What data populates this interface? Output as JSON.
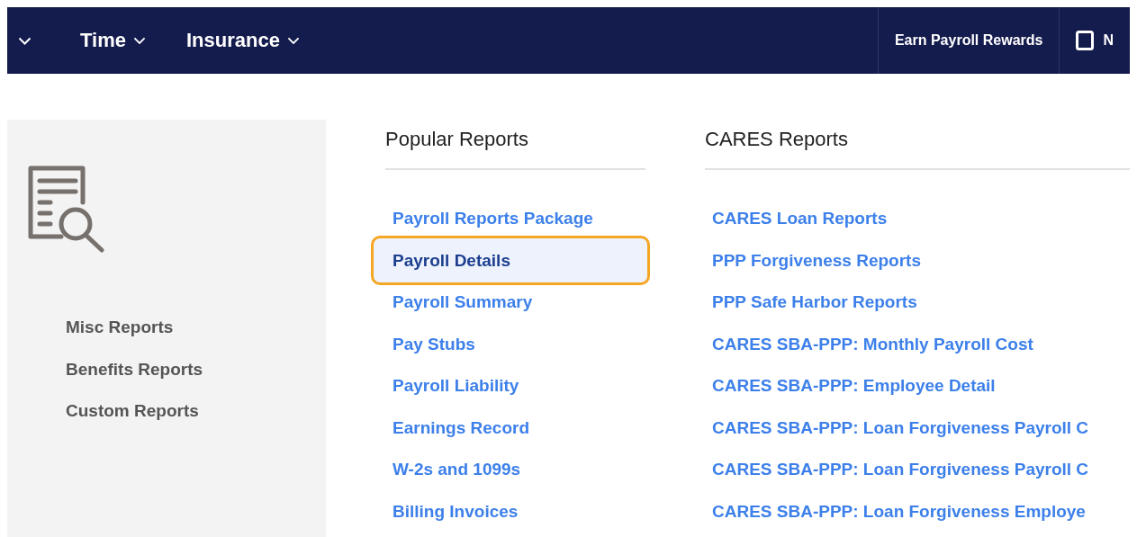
{
  "nav": {
    "items": [
      {
        "label": "Time"
      },
      {
        "label": "Insurance"
      }
    ],
    "right": {
      "rewards": "Earn Payroll Rewards",
      "cut_label": "N"
    }
  },
  "sidebar": {
    "items": [
      "Misc Reports",
      "Benefits Reports",
      "Custom Reports"
    ]
  },
  "columns": [
    {
      "title": "Popular Reports",
      "items": [
        {
          "label": "Payroll Reports Package",
          "selected": false
        },
        {
          "label": "Payroll Details",
          "selected": true
        },
        {
          "label": "Payroll Summary",
          "selected": false
        },
        {
          "label": "Pay Stubs",
          "selected": false
        },
        {
          "label": "Payroll Liability",
          "selected": false
        },
        {
          "label": "Earnings Record",
          "selected": false
        },
        {
          "label": "W-2s and 1099s",
          "selected": false
        },
        {
          "label": "Billing Invoices",
          "selected": false
        }
      ]
    },
    {
      "title": "CARES Reports",
      "items": [
        {
          "label": "CARES Loan Reports",
          "selected": false
        },
        {
          "label": "PPP Forgiveness Reports",
          "selected": false
        },
        {
          "label": "PPP Safe Harbor Reports",
          "selected": false
        },
        {
          "label": "CARES SBA-PPP: Monthly Payroll Cost",
          "selected": false
        },
        {
          "label": "CARES SBA-PPP: Employee Detail",
          "selected": false
        },
        {
          "label": "CARES SBA-PPP: Loan Forgiveness Payroll C",
          "selected": false
        },
        {
          "label": "CARES SBA-PPP: Loan Forgiveness Payroll C",
          "selected": false
        },
        {
          "label": "CARES SBA-PPP: Loan Forgiveness Employe",
          "selected": false
        }
      ]
    }
  ]
}
